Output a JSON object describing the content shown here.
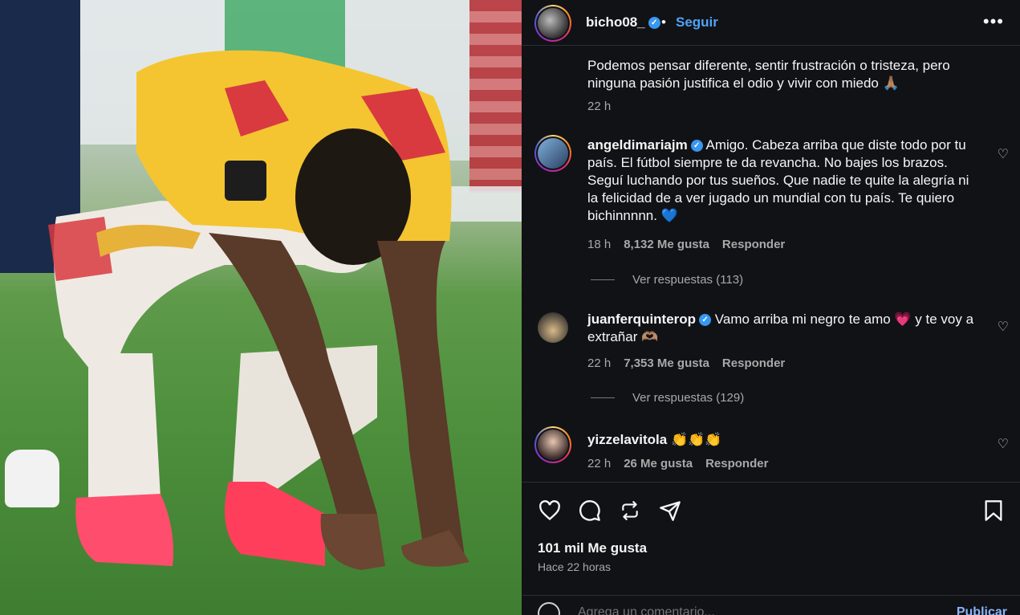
{
  "post": {
    "username": "bicho08_",
    "follow_label": "Seguir",
    "more_label": "•••",
    "caption": "Podemos pensar diferente, sentir frustración o tristeza, pero ninguna pasión justifica el odio y vivir con miedo 🙏🏽",
    "caption_time": "22 h"
  },
  "comments": [
    {
      "username": "angeldimariajm",
      "text": "Amigo. Cabeza arriba que diste todo por tu país. El fútbol siempre te da revancha. No bajes los brazos. Seguí luchando por tus sueños. Que nadie te quite la alegría ni la felicidad de a ver jugado un mundial con tu país. Te quiero bichinnnnn. 💙",
      "time": "18 h",
      "likes": "8,132 Me gusta",
      "reply": "Responder",
      "view_replies": "Ver respuestas (113)"
    },
    {
      "username": "juanferquinterop",
      "text": "Vamo arriba mi negro te amo 💗 y te voy a extrañar 🫶🏽",
      "time": "22 h",
      "likes": "7,353 Me gusta",
      "reply": "Responder",
      "view_replies": "Ver respuestas (129)"
    },
    {
      "username": "yizzelavitola",
      "text": "👏👏👏",
      "time": "22 h",
      "likes": "26 Me gusta",
      "reply": "Responder"
    }
  ],
  "footer": {
    "likes": "101 mil Me gusta",
    "posted": "Hace 22 horas",
    "comment_placeholder": "Agrega un comentario...",
    "publish_label": "Publicar"
  },
  "icons": [
    "heart-icon",
    "comment-icon",
    "repost-icon",
    "share-icon",
    "bookmark-icon"
  ],
  "colors": {
    "panel_bg": "#111216",
    "link_blue": "#4fa3f7",
    "verified": "#3897f0"
  }
}
